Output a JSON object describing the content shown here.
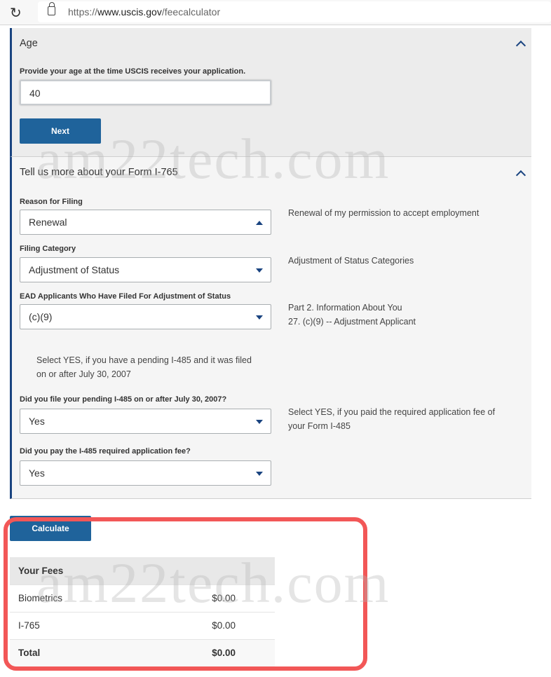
{
  "browser": {
    "url_prefix": "https://",
    "url_domain": "www.uscis.gov",
    "url_path": "/feecalculator"
  },
  "age": {
    "title": "Age",
    "label": "Provide your age at the time USCIS receives your application.",
    "value": "40",
    "next": "Next"
  },
  "form": {
    "title": "Tell us more about your Form I-765",
    "fields": [
      {
        "label": "Reason for Filing",
        "value": "Renewal",
        "hint": "Renewal of my permission to accept employment"
      },
      {
        "label": "Filing Category",
        "value": "Adjustment of Status",
        "hint": "Adjustment of Status Categories"
      },
      {
        "label": "EAD Applicants Who Have Filed For Adjustment of Status",
        "value": "(c)(9)",
        "hint": "Part 2. Information About You",
        "hint2": "27. (c)(9) -- Adjustment Applicant"
      },
      {
        "label": "Did you file your pending I-485 on or after July 30, 2007?",
        "value": "Yes",
        "hint": "Select YES, if you paid the required application fee of your Form I-485"
      },
      {
        "label": "Did you pay the I-485 required application fee?",
        "value": "Yes"
      }
    ],
    "note": "Select YES, if you have a pending I-485 and it was filed on or after July 30, 2007"
  },
  "calculate": "Calculate",
  "fees": {
    "header": "Your Fees",
    "rows": [
      {
        "name": "Biometrics",
        "amount": "$0.00"
      },
      {
        "name": "I-765",
        "amount": "$0.00"
      }
    ],
    "total_label": "Total",
    "total": "$0.00"
  },
  "watermark": "am22tech.com",
  "colors": {
    "accent": "#1f639b",
    "highlight": "#f25757"
  }
}
